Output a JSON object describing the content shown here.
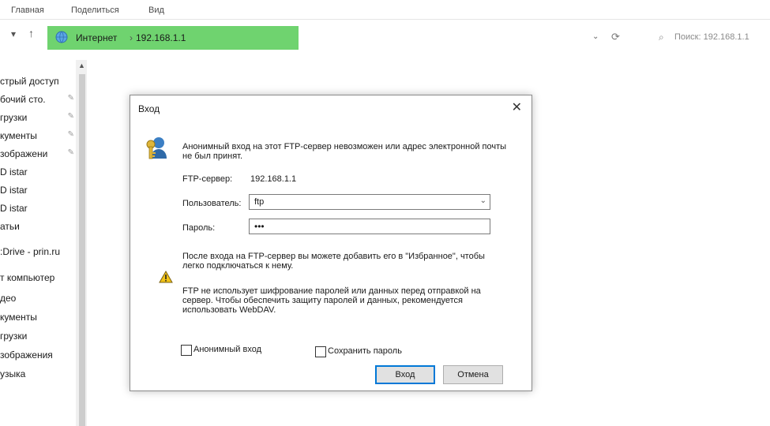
{
  "ribbon": {
    "tabs": [
      "Главная",
      "Поделиться",
      "Вид"
    ]
  },
  "address": {
    "location": "Интернет",
    "path": "192.168.1.1"
  },
  "search": {
    "placeholder": "Поиск: 192.168.1.1"
  },
  "sidebar": {
    "items": [
      {
        "label": "стрый доступ",
        "pinned": false
      },
      {
        "label": "бочий сто.",
        "pinned": true
      },
      {
        "label": "грузки",
        "pinned": true
      },
      {
        "label": "кументы",
        "pinned": true
      },
      {
        "label": "зображени",
        "pinned": true
      },
      {
        "label": "D istar",
        "pinned": false
      },
      {
        "label": "D istar",
        "pinned": false
      },
      {
        "label": "D istar",
        "pinned": false
      },
      {
        "label": "атьи",
        "pinned": false
      },
      {
        "label": ":Drive - prin.ru",
        "pinned": false
      },
      {
        "label": "т компьютер",
        "pinned": false
      },
      {
        "label": "део",
        "pinned": false
      },
      {
        "label": "кументы",
        "pinned": false
      },
      {
        "label": "грузки",
        "pinned": false
      },
      {
        "label": "зображения",
        "pinned": false
      },
      {
        "label": "узыка",
        "pinned": false
      }
    ]
  },
  "dialog": {
    "title": "Вход",
    "message_line1": "Анонимный вход на этот FTP-сервер невозможен или адрес электронной почты",
    "message_line2": "не был принят.",
    "server_label": "FTP-сервер:",
    "server_value": "192.168.1.1",
    "user_label": "Пользователь:",
    "user_value": "ftp",
    "password_label": "Пароль:",
    "password_value": "•••",
    "info_line1": "После входа на FTP-сервер вы можете добавить его в \"Избранное\", чтобы",
    "info_line2": "легко подключаться к нему.",
    "warn_line1": "FTP не использует шифрование паролей или данных перед отправкой на",
    "warn_line2": "сервер. Чтобы обеспечить защиту паролей и данных, рекомендуется",
    "warn_line3": "использовать WebDAV.",
    "anonymous_label": "Анонимный вход",
    "save_password_label": "Сохранить пароль",
    "login_button": "Вход",
    "cancel_button": "Отмена"
  },
  "colors": {
    "address_bar": "#6fd36f",
    "default_button_border": "#0078d7"
  },
  "icons": [
    "back-arrow-icon",
    "up-arrow-icon",
    "globe-icon",
    "chevron-down-icon",
    "refresh-icon",
    "search-icon",
    "key-user-icon",
    "warning-icon",
    "close-icon",
    "pin-icon"
  ]
}
